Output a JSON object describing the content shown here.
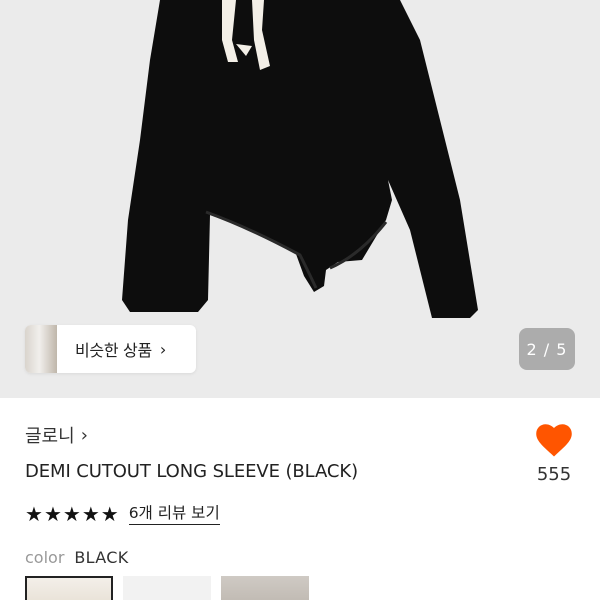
{
  "gallery": {
    "similar_products_label": "비슷한 상품",
    "page_indicator": "2 / 5"
  },
  "product": {
    "brand": "글로니",
    "title": "DEMI CUTOUT LONG SLEEVE (BLACK)",
    "like_count": "555",
    "rating_stars": 5,
    "review_link": "6개 리뷰 보기",
    "color_key": "color",
    "color_value": "BLACK"
  },
  "colors": {
    "heart": "#ff5500",
    "hero_bg": "#ebebeb",
    "garment": "#0d0d0d"
  },
  "icons": {
    "brand_chevron": "chevron-right-icon",
    "like": "heart-icon",
    "star": "star-icon"
  }
}
